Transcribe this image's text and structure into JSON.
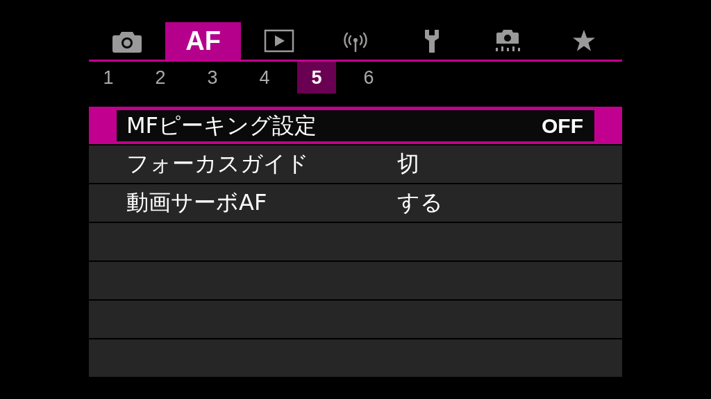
{
  "tabs": [
    {
      "kind": "camera",
      "selected": false
    },
    {
      "kind": "text",
      "label": "AF",
      "selected": true
    },
    {
      "kind": "play",
      "selected": false
    },
    {
      "kind": "wireless",
      "selected": false
    },
    {
      "kind": "wrench",
      "selected": false
    },
    {
      "kind": "custom",
      "selected": false
    },
    {
      "kind": "star",
      "selected": false
    }
  ],
  "pages": [
    {
      "label": "1",
      "selected": false
    },
    {
      "label": "2",
      "selected": false
    },
    {
      "label": "3",
      "selected": false
    },
    {
      "label": "4",
      "selected": false
    },
    {
      "label": "5",
      "selected": true
    },
    {
      "label": "6",
      "selected": false
    }
  ],
  "rows": [
    {
      "kind": "setting",
      "label": "MFピーキング設定",
      "value": "OFF",
      "selected": true
    },
    {
      "kind": "setting",
      "label": "フォーカスガイド",
      "value": "切",
      "selected": false
    },
    {
      "kind": "setting",
      "label": "動画サーボAF",
      "value": "する",
      "selected": false
    },
    {
      "kind": "blank"
    },
    {
      "kind": "blank"
    },
    {
      "kind": "blank"
    },
    {
      "kind": "blank"
    }
  ]
}
